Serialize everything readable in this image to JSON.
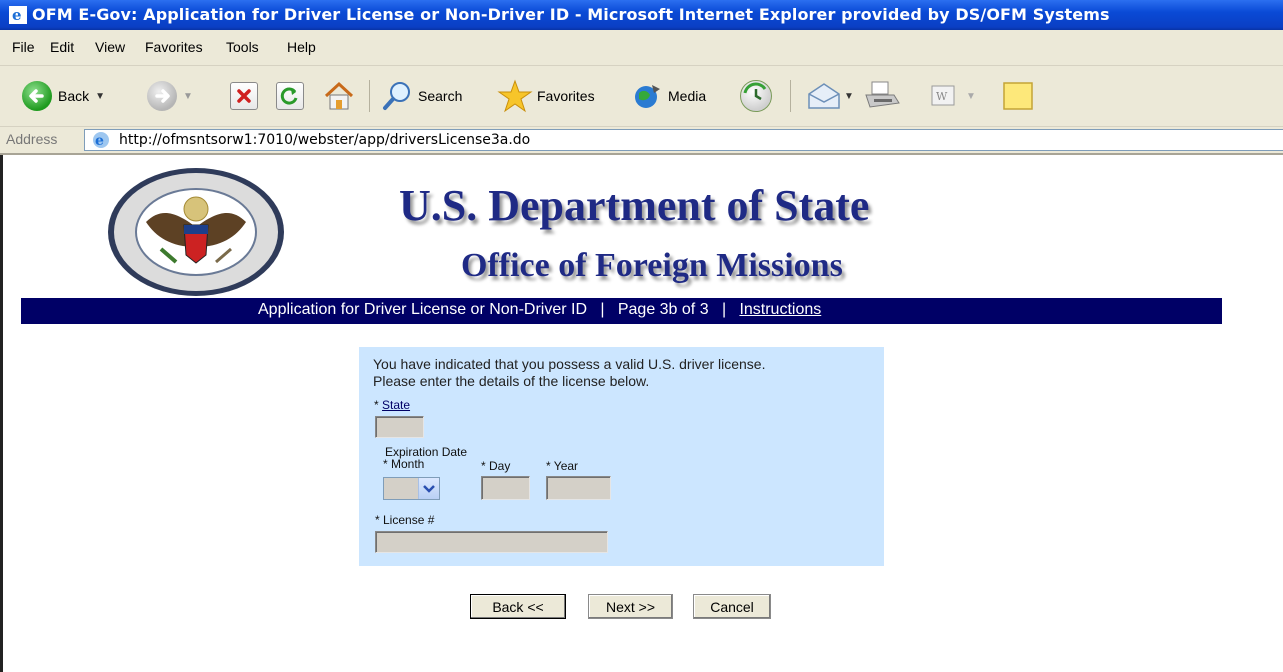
{
  "window": {
    "title": "OFM E-Gov: Application for Driver License or Non-Driver ID - Microsoft Internet Explorer provided by DS/OFM Systems"
  },
  "menu": [
    "File",
    "Edit",
    "View",
    "Favorites",
    "Tools",
    "Help"
  ],
  "toolbar": {
    "back_label": "Back",
    "search_label": "Search",
    "favorites_label": "Favorites",
    "media_label": "Media"
  },
  "address": {
    "label": "Address",
    "url": "http://ofmsntsorw1:7010/webster/app/driversLicense3a.do"
  },
  "header": {
    "title": "U.S. Department of State",
    "subtitle": "Office of Foreign Missions"
  },
  "nav": {
    "app_title": "Application for Driver License or Non-Driver ID",
    "page": "Page 3b of 3",
    "instructions": "Instructions",
    "separator": "|"
  },
  "form": {
    "intro_line1": "You have indicated that you possess a valid U.S. driver license.",
    "intro_line2": "Please enter the details of the license below.",
    "state_label": "State",
    "required_marker": "*",
    "expiration_label": "Expiration Date",
    "month_label": "* Month",
    "day_label": "* Day",
    "year_label": "* Year",
    "license_label": "* License #",
    "state_value": "",
    "month_value": "",
    "day_value": "",
    "year_value": "",
    "license_value": ""
  },
  "buttons": {
    "back": "Back <<",
    "next": "Next >>",
    "cancel": "Cancel"
  }
}
